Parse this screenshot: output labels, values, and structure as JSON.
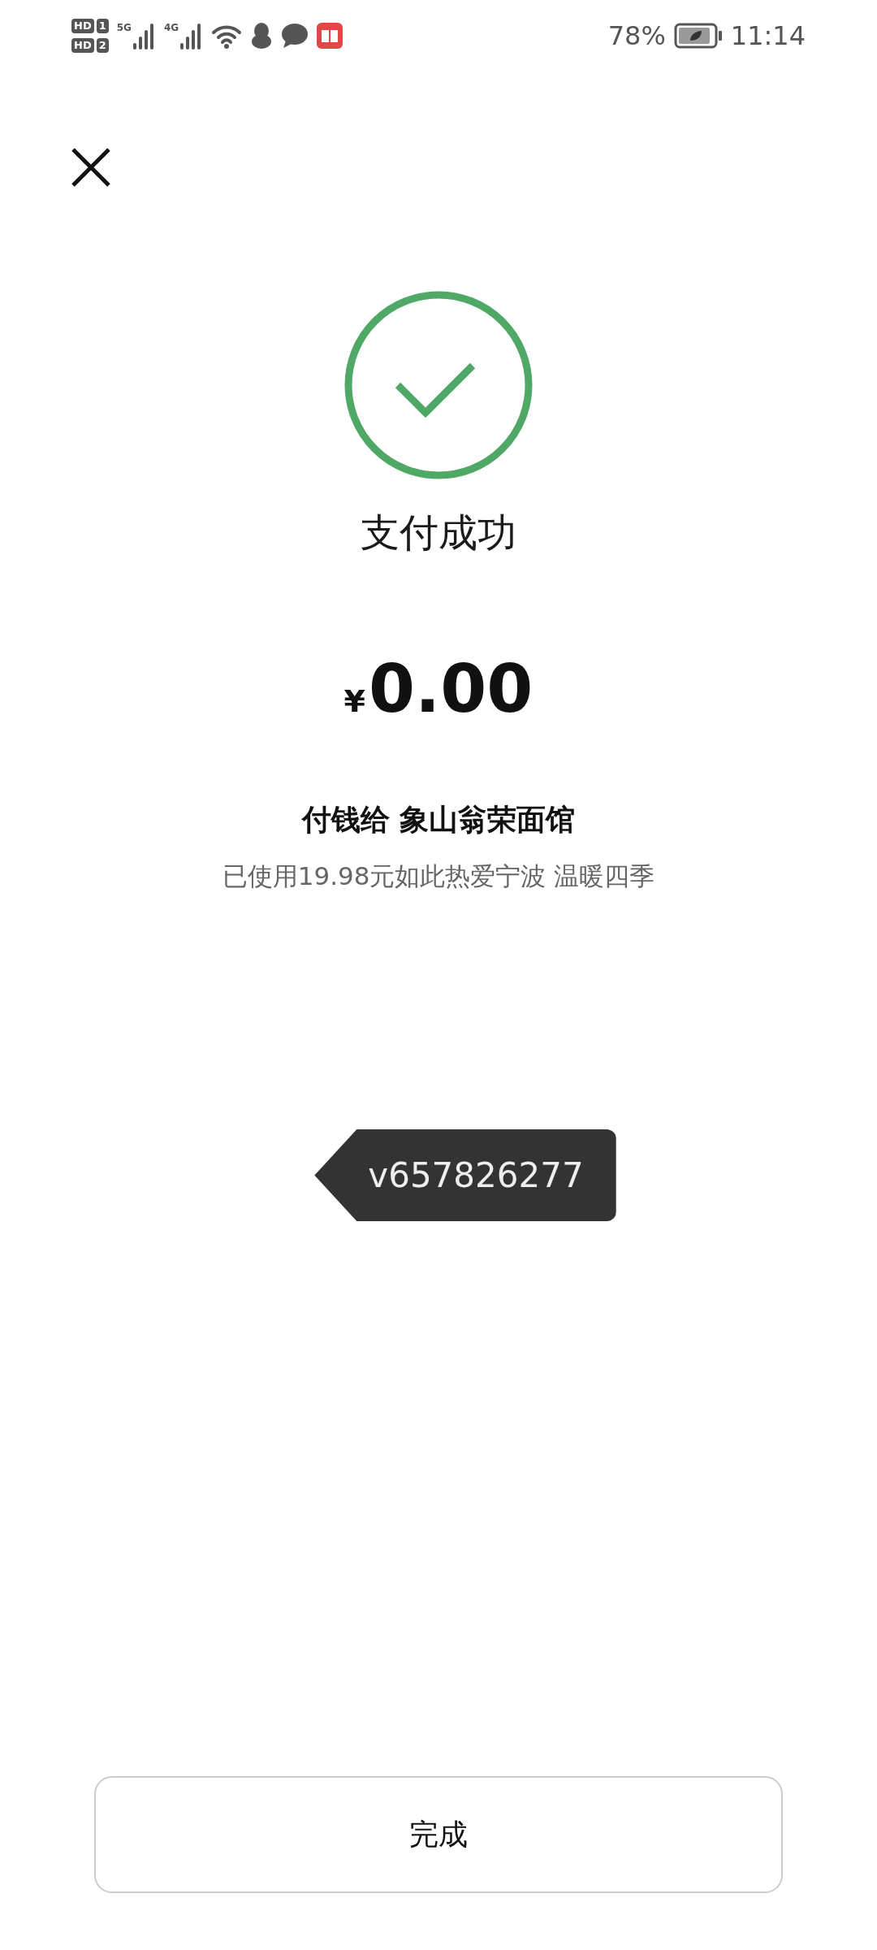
{
  "status_bar": {
    "sims": [
      {
        "label": "HD",
        "slot": "1"
      },
      {
        "label": "HD",
        "slot": "2"
      }
    ],
    "networks": [
      "5G",
      "4G"
    ],
    "battery": "78%",
    "time": "11:14"
  },
  "result": {
    "title": "支付成功",
    "currency": "¥",
    "amount": "0.00",
    "payee": "付钱给 象山翁荣面馆",
    "note": "已使用19.98元如此热爱宁波 温暖四季"
  },
  "tag": "v657826277",
  "done_button": "完成"
}
